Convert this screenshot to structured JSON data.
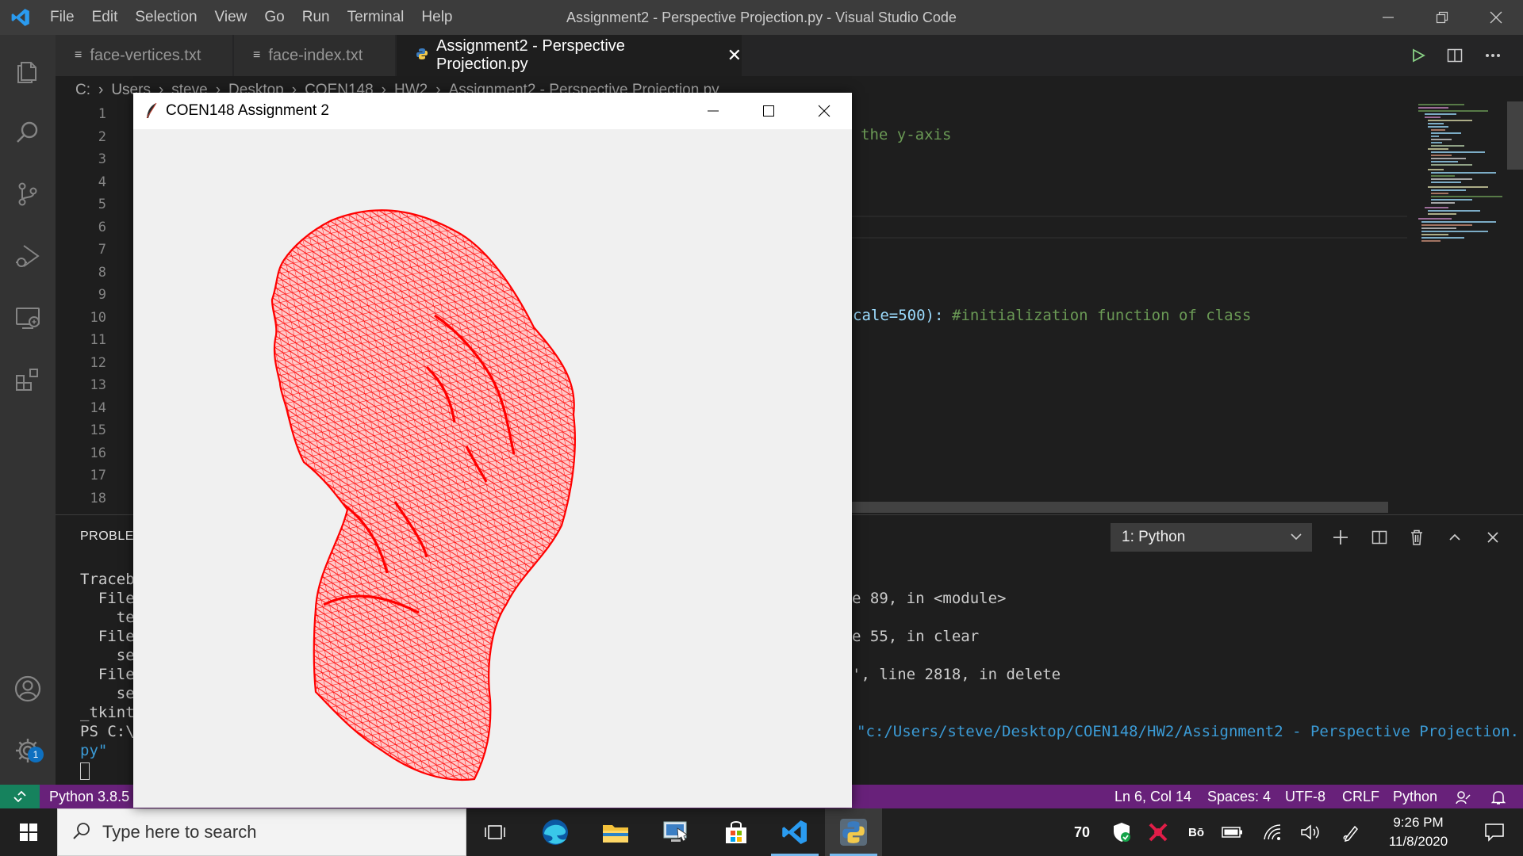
{
  "titlebar": {
    "menus": [
      "File",
      "Edit",
      "Selection",
      "View",
      "Go",
      "Run",
      "Terminal",
      "Help"
    ],
    "title": "Assignment2 - Perspective Projection.py - Visual Studio Code"
  },
  "activity": {
    "items": [
      "explorer-icon",
      "search-icon",
      "source-control-icon",
      "run-debug-icon",
      "remote-explorer-icon",
      "extensions-icon"
    ],
    "bottom": [
      "account-icon",
      "settings-gear-icon"
    ],
    "settings_badge": "1"
  },
  "tabs": [
    {
      "label": "face-vertices.txt",
      "active": false
    },
    {
      "label": "face-index.txt",
      "active": false
    },
    {
      "label": "Assignment2 - Perspective Projection.py",
      "active": true,
      "close": "✕"
    }
  ],
  "breadcrumb": [
    "C:",
    "Users",
    "steve",
    "Desktop",
    "COEN148",
    "HW2",
    "Assignment2 - Perspective Projection.py"
  ],
  "editor": {
    "line_numbers": [
      "1",
      "2",
      "3",
      "4",
      "5",
      "6",
      "7",
      "8",
      "9",
      "10",
      "11",
      "12",
      "13",
      "14",
      "15",
      "16",
      "17",
      "18"
    ],
    "frag_line2": "the y-axis",
    "frag_line10_code": "cale=500):",
    "frag_line10_comment": "#initialization function of class"
  },
  "panel": {
    "title": "PROBLEM",
    "terminal_select": "1: Python",
    "left_lines": [
      "Traceb",
      "  File",
      "    te",
      "  File",
      "    se",
      "  File",
      "    se",
      "_tkint",
      "PS C:\\",
      "py\""
    ],
    "right_lines": [
      "e 89, in <module>",
      "e 55, in clear",
      "', line 2818, in delete",
      "\"c:/Users/steve/Desktop/COEN148/HW2/Assignment2 - Perspective Projection."
    ]
  },
  "statusbar": {
    "python": "Python 3.8.5",
    "position": "Ln 6, Col 14",
    "spaces": "Spaces: 4",
    "encoding": "UTF-8",
    "eol": "CRLF",
    "language": "Python"
  },
  "taskbar": {
    "search_placeholder": "Type here to search",
    "apps": [
      "task-view-icon",
      "edge-icon",
      "file-explorer-icon",
      "remote-desktop-icon",
      "store-icon",
      "vscode-icon",
      "python-icon"
    ],
    "tray_number": "70",
    "time": "9:26 PM",
    "date": "11/8/2020"
  },
  "tk_window": {
    "title": "COEN148 Assignment 2",
    "mesh_color": "#ff0000"
  },
  "colors": {
    "statusbar": "#68217a",
    "accent": "#007acc",
    "comment": "#6a9955"
  }
}
